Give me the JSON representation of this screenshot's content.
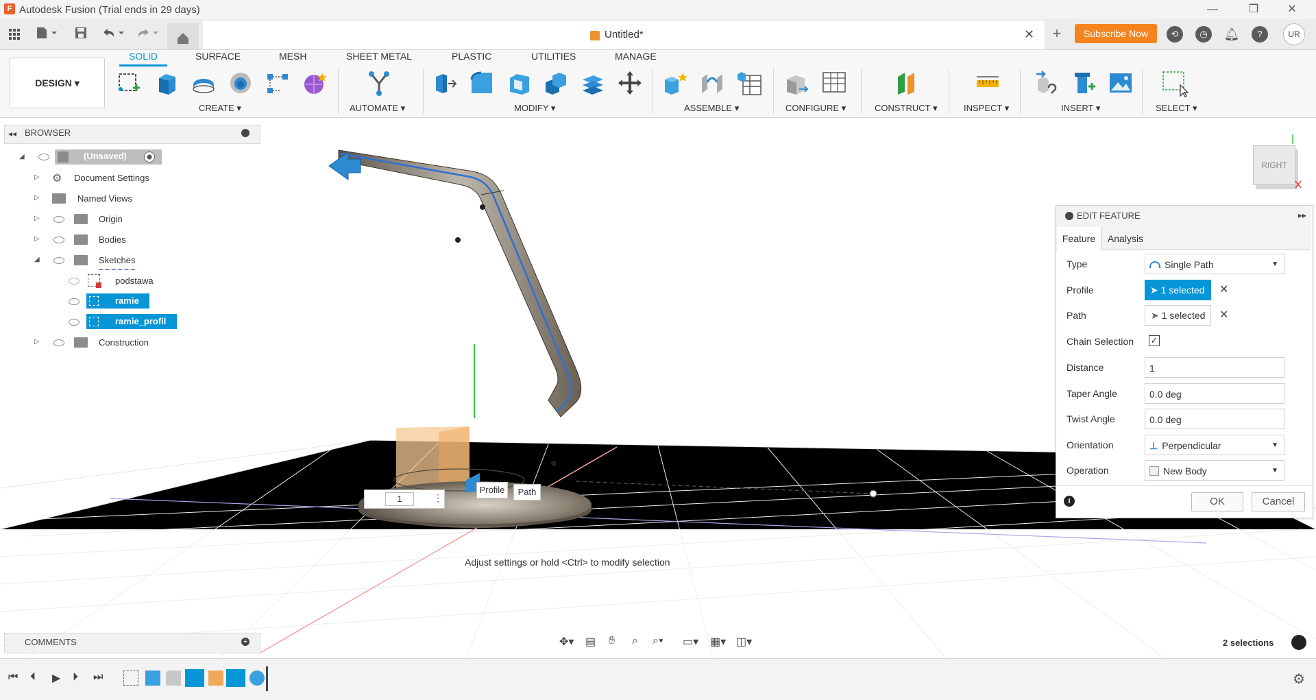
{
  "window": {
    "title": "Autodesk Fusion (Trial ends in 29 days)",
    "minimize": "—",
    "restore": "❐",
    "close": "✕"
  },
  "document": {
    "title": "Untitled*",
    "close": "✕"
  },
  "header": {
    "subscribe_label": "Subscribe Now",
    "avatar": "UR"
  },
  "workspace": {
    "label": "DESIGN ▾"
  },
  "tabs": [
    "SOLID",
    "SURFACE",
    "MESH",
    "SHEET METAL",
    "PLASTIC",
    "UTILITIES",
    "MANAGE"
  ],
  "groups": [
    "CREATE ▾",
    "AUTOMATE ▾",
    "MODIFY ▾",
    "ASSEMBLE ▾",
    "CONFIGURE ▾",
    "CONSTRUCT ▾",
    "INSPECT ▾",
    "INSERT ▾",
    "SELECT ▾"
  ],
  "browser": {
    "title": "BROWSER",
    "root": "(Unsaved)",
    "items": [
      "Document Settings",
      "Named Views",
      "Origin",
      "Bodies",
      "Sketches",
      "podstawa",
      "ramie",
      "ramie_profil",
      "Construction"
    ]
  },
  "edit_feature": {
    "title": "EDIT FEATURE",
    "tabs": [
      "Feature",
      "Analysis"
    ],
    "fields": {
      "type_label": "Type",
      "type_value": "Single Path",
      "profile_label": "Profile",
      "profile_value": "1 selected",
      "path_label": "Path",
      "path_value": "1 selected",
      "chain_label": "Chain Selection",
      "distance_label": "Distance",
      "distance_value": "1",
      "taper_label": "Taper Angle",
      "taper_value": "0.0 deg",
      "twist_label": "Twist Angle",
      "twist_value": "0.0 deg",
      "orientation_label": "Orientation",
      "orientation_value": "Perpendicular",
      "operation_label": "Operation",
      "operation_value": "New Body"
    },
    "ok_label": "OK",
    "cancel_label": "Cancel"
  },
  "viewport": {
    "hint": "Adjust settings or hold <Ctrl> to modify selection",
    "profile_tag": "Profile",
    "path_tag": "Path",
    "distance_input": "1",
    "viewcube_face": "RIGHT"
  },
  "comments": {
    "title": "COMMENTS"
  },
  "status": {
    "selections": "2 selections"
  }
}
